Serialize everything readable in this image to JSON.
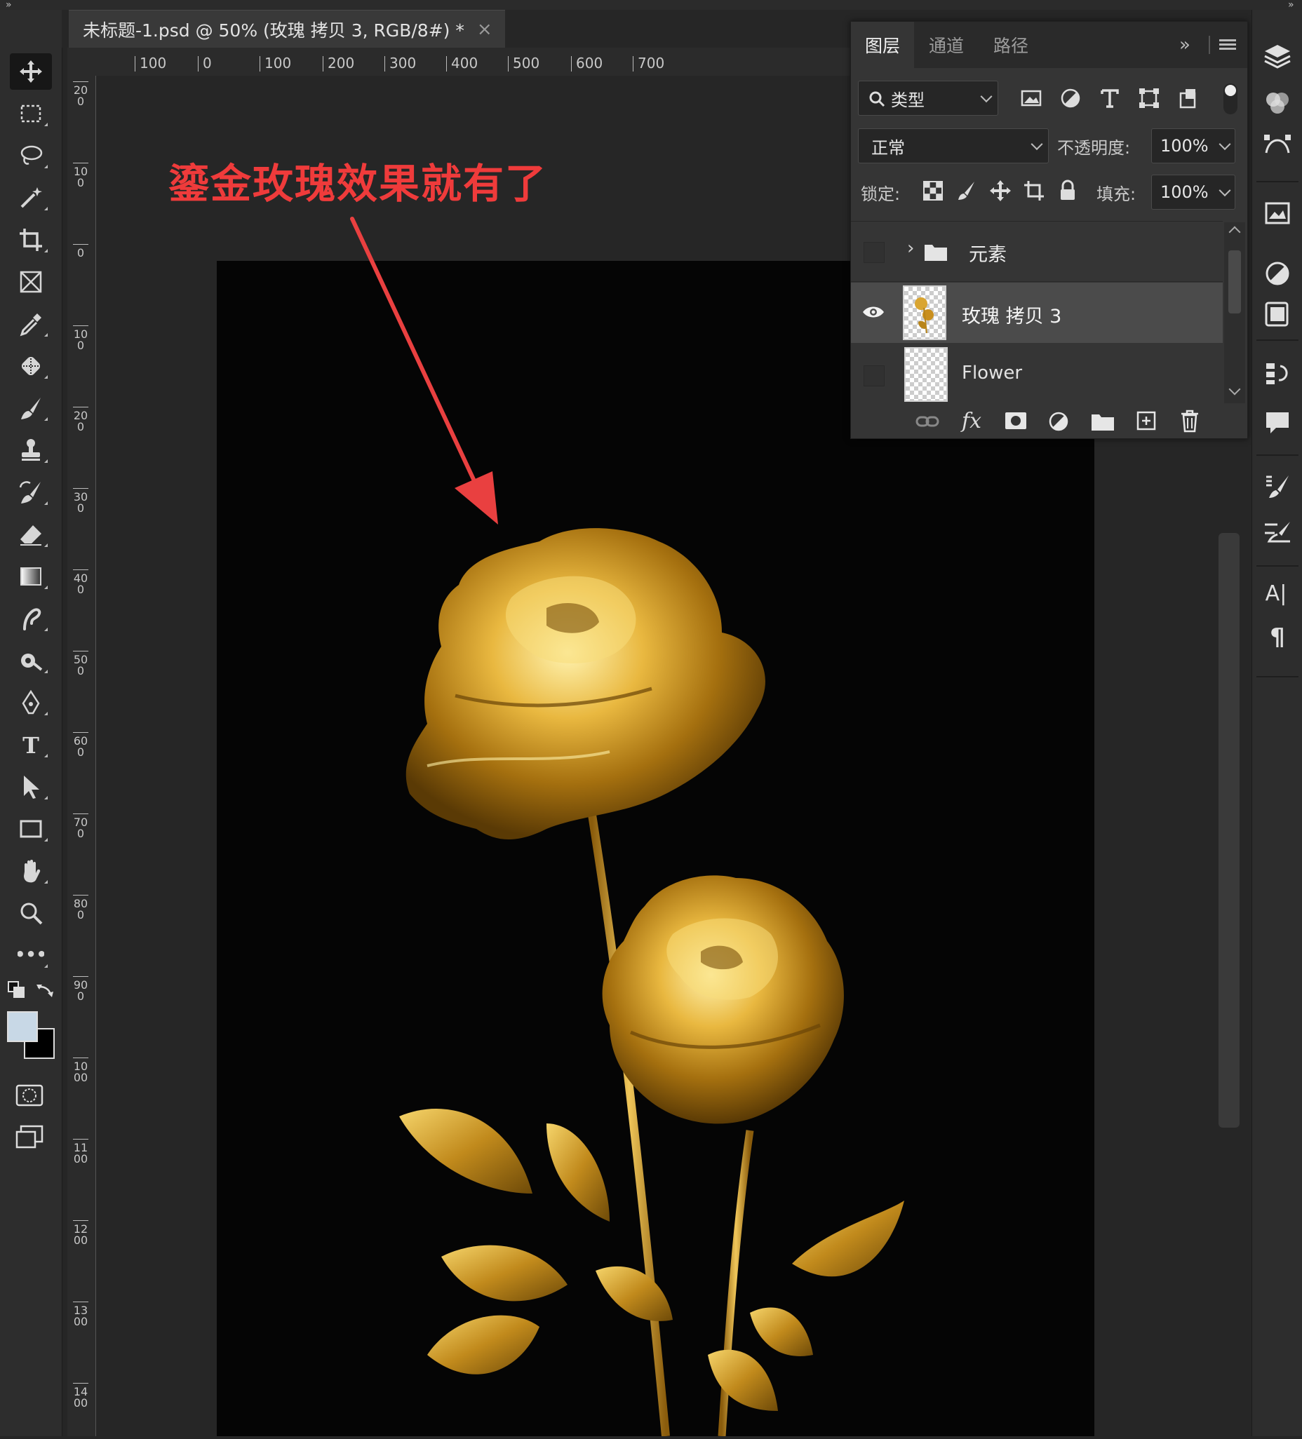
{
  "document": {
    "tab_title": "未标题-1.psd @ 50% (玫瑰 拷贝 3, RGB/8#) *",
    "close_glyph": "×"
  },
  "rulers": {
    "horizontal": [
      "100",
      "0",
      "100",
      "200",
      "300",
      "400",
      "500",
      "600",
      "700"
    ],
    "vertical": [
      "200",
      "100",
      "0",
      "100",
      "200",
      "300",
      "400",
      "500",
      "600",
      "700",
      "800",
      "900",
      "1000",
      "1100",
      "1200",
      "1300",
      "1400"
    ]
  },
  "annotation": {
    "text": "鎏金玫瑰效果就有了",
    "color": "#ef3b3b"
  },
  "toolbar": {
    "tools": [
      {
        "name": "move-tool",
        "icon": "move-icon"
      },
      {
        "name": "marquee-tool",
        "icon": "rect-marquee-icon"
      },
      {
        "name": "lasso-tool",
        "icon": "lasso-icon"
      },
      {
        "name": "magic-wand-tool",
        "icon": "magic-wand-icon"
      },
      {
        "name": "crop-tool",
        "icon": "crop-icon"
      },
      {
        "name": "frame-tool",
        "icon": "frame-icon"
      },
      {
        "name": "eyedropper-tool",
        "icon": "eyedropper-icon"
      },
      {
        "name": "healing-brush-tool",
        "icon": "healing-brush-icon"
      },
      {
        "name": "brush-tool",
        "icon": "brush-icon"
      },
      {
        "name": "clone-stamp-tool",
        "icon": "stamp-icon"
      },
      {
        "name": "history-brush-tool",
        "icon": "history-brush-icon"
      },
      {
        "name": "eraser-tool",
        "icon": "eraser-icon"
      },
      {
        "name": "gradient-tool",
        "icon": "gradient-icon"
      },
      {
        "name": "smudge-tool",
        "icon": "smudge-icon"
      },
      {
        "name": "dodge-tool",
        "icon": "dodge-icon"
      },
      {
        "name": "pen-tool",
        "icon": "pen-icon"
      },
      {
        "name": "type-tool",
        "icon": "type-icon"
      },
      {
        "name": "path-selection-tool",
        "icon": "arrow-icon"
      },
      {
        "name": "rectangle-tool",
        "icon": "rectangle-icon"
      },
      {
        "name": "hand-tool",
        "icon": "hand-icon"
      },
      {
        "name": "zoom-tool",
        "icon": "zoom-icon"
      },
      {
        "name": "edit-toolbar",
        "icon": "more-icon"
      }
    ],
    "type_glyph": "T",
    "more_glyph": "•••",
    "foreground_color": "#c8d8e6",
    "background_color": "#000000"
  },
  "layers_panel": {
    "tabs": [
      "图层",
      "通道",
      "路径"
    ],
    "active_tab": "图层",
    "filter_label": "类型",
    "blend_mode": "正常",
    "opacity_label": "不透明度:",
    "opacity_value": "100%",
    "lock_label": "锁定:",
    "fill_label": "填充:",
    "fill_value": "100%",
    "layers": [
      {
        "name": "元素",
        "type": "group",
        "visible": false
      },
      {
        "name": "玫瑰 拷贝 3",
        "type": "pixel",
        "visible": true,
        "selected": true
      },
      {
        "name": "Flower",
        "type": "pixel",
        "visible": false
      }
    ],
    "footer_icons": [
      "link-icon",
      "fx-icon",
      "mask-icon",
      "adjustment-icon",
      "folder-icon",
      "new-layer-icon",
      "trash-icon"
    ],
    "fx_glyph": "fx"
  },
  "right_dock": {
    "icons": [
      "layers-icon",
      "channels-icon",
      "paths-icon",
      "libraries-icon",
      "adjustments-icon",
      "properties-icon",
      "history-icon",
      "comments-icon",
      "brush-settings-icon",
      "brushes-icon",
      "character-icon",
      "paragraph-icon"
    ],
    "character_glyph": "A|",
    "paragraph_glyph": "¶"
  },
  "colors": {
    "ui_bg": "#262626",
    "panel_bg": "#353535",
    "selected_layer": "#4b4b4b",
    "gold": "#d9a531",
    "arrow": "#e94040"
  }
}
